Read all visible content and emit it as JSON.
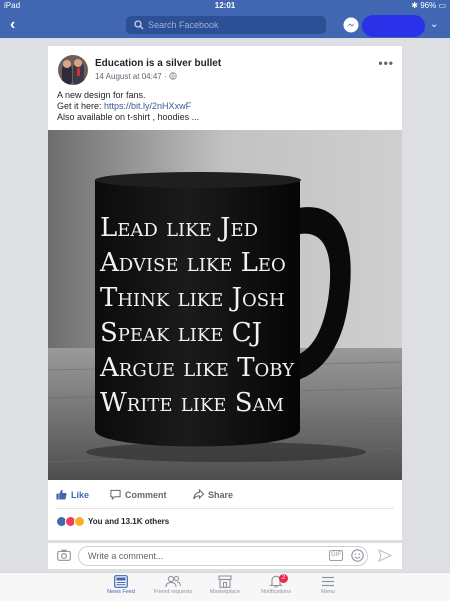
{
  "status_bar": {
    "device": "iPad",
    "time": "12:01",
    "battery": "96%"
  },
  "header": {
    "search_placeholder": "Search Facebook"
  },
  "post": {
    "author": "Education is a silver bullet",
    "date": "14 August at 04:47",
    "meta_separator": "·",
    "text_line1": "A new design for fans.",
    "text_line2_prefix": "Get it here: ",
    "link": "https://bit.ly/2nHXxwF",
    "text_line3": "Also available on t-shirt , hoodies ...",
    "image_lines": [
      "Lead like Jed",
      "Advise like Leo",
      "Think like Josh",
      "Speak like CJ",
      "Argue like Toby",
      "Write like Sam"
    ]
  },
  "actions": {
    "like": "Like",
    "comment": "Comment",
    "share": "Share"
  },
  "reactions": {
    "summary": "You and 13.1K others"
  },
  "comment_box": {
    "placeholder": "Write a comment...",
    "gif_label": "GIF"
  },
  "tabbar": {
    "items": [
      {
        "label": "News Feed"
      },
      {
        "label": "Friend requests"
      },
      {
        "label": "Marketplace"
      },
      {
        "label": "Notifications",
        "badge": "2"
      },
      {
        "label": "Menu"
      }
    ]
  },
  "colors": {
    "brand": "#4267b2",
    "link": "#385898",
    "badge": "#f02849"
  }
}
